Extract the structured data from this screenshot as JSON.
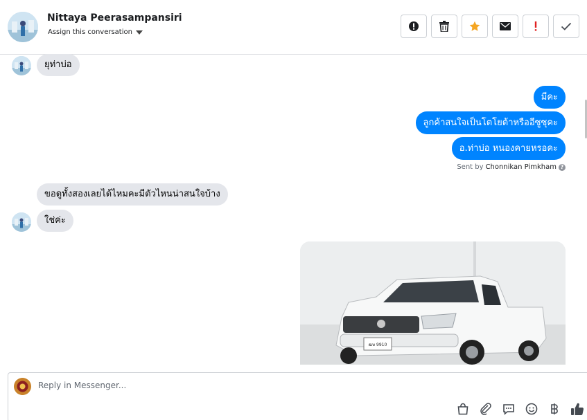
{
  "header": {
    "contact_name": "Nittaya Peerasampansiri",
    "assign_label": "Assign this conversation"
  },
  "toolbar": {
    "buttons": [
      {
        "icon": "alert-circle-icon"
      },
      {
        "icon": "trash-icon"
      },
      {
        "icon": "star-icon",
        "color": "#f5a623"
      },
      {
        "icon": "envelope-icon"
      },
      {
        "icon": "exclamation-icon",
        "color": "#e02020"
      },
      {
        "icon": "checkmark-icon"
      }
    ]
  },
  "messages": {
    "incoming_1": "ยุท่าบ่อ",
    "outgoing": [
      "มีคะ",
      "ลูกค้าสนใจเป็นโตโยต้าหรืออีซูซุคะ",
      "อ.ท่าบ่อ หนองคายหรอคะ"
    ],
    "sent_by_prefix": "Sent by",
    "sent_by_name": "Chonnikan Pimkham",
    "incoming_2": "ขอดูทั้งสองเลยได้ไหมคะมีตัวไหนน่าสนใจบ้าง",
    "incoming_3": "ใช่ค่ะ",
    "photo_plate": "ฒษ 9910"
  },
  "composer": {
    "placeholder": "Reply in Messenger...",
    "tools": [
      "shopping-bag-icon",
      "paperclip-icon",
      "saved-reply-icon",
      "emoji-icon",
      "baht-icon",
      "thumbs-up-icon"
    ]
  },
  "colors": {
    "outgoing_bubble": "#0084ff",
    "incoming_bubble": "#e4e6eb"
  }
}
